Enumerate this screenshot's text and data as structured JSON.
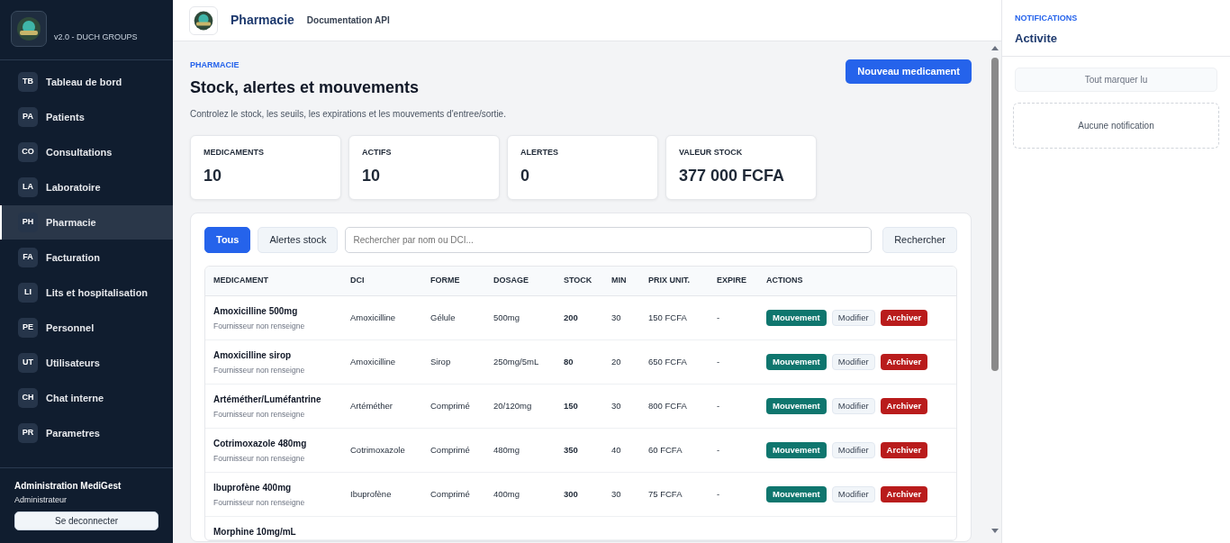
{
  "sidebar": {
    "version": "v2.0 - DUCH GROUPS",
    "items": [
      {
        "badge": "TB",
        "label": "Tableau de bord",
        "selected": false
      },
      {
        "badge": "PA",
        "label": "Patients",
        "selected": false
      },
      {
        "badge": "CO",
        "label": "Consultations",
        "selected": false
      },
      {
        "badge": "LA",
        "label": "Laboratoire",
        "selected": false
      },
      {
        "badge": "PH",
        "label": "Pharmacie",
        "selected": true
      },
      {
        "badge": "FA",
        "label": "Facturation",
        "selected": false
      },
      {
        "badge": "LI",
        "label": "Lits et hospitalisation",
        "selected": false
      },
      {
        "badge": "PE",
        "label": "Personnel",
        "selected": false
      },
      {
        "badge": "UT",
        "label": "Utilisateurs",
        "selected": false
      },
      {
        "badge": "CH",
        "label": "Chat interne",
        "selected": false
      },
      {
        "badge": "PR",
        "label": "Parametres",
        "selected": false
      }
    ],
    "user": {
      "name": "Administration MediGest",
      "role": "Administrateur"
    },
    "logout": "Se deconnecter"
  },
  "header": {
    "title": "Pharmacie",
    "link": "Documentation API"
  },
  "page": {
    "eyebrow": "PHARMACIE",
    "title": "Stock, alertes et mouvements",
    "subtitle": "Controlez le stock, les seuils, les expirations et les mouvements d'entree/sortie.",
    "new_button": "Nouveau medicament"
  },
  "stats": [
    {
      "label": "MEDICAMENTS",
      "value": "10"
    },
    {
      "label": "ACTIFS",
      "value": "10"
    },
    {
      "label": "ALERTES",
      "value": "0"
    },
    {
      "label": "VALEUR STOCK",
      "value": "377 000 FCFA"
    }
  ],
  "filters": [
    {
      "label": "Tous",
      "selected": true
    },
    {
      "label": "Alertes stock",
      "selected": false
    }
  ],
  "search": {
    "placeholder": "Rechercher par nom ou DCI...",
    "button": "Rechercher"
  },
  "table": {
    "columns": [
      "MEDICAMENT",
      "DCI",
      "FORME",
      "DOSAGE",
      "STOCK",
      "MIN",
      "PRIX UNIT.",
      "EXPIRE",
      "ACTIONS"
    ],
    "rows": [
      {
        "name": "Amoxicilline 500mg",
        "supplier": "Fournisseur non renseigne",
        "dci": "Amoxicilline",
        "forme": "Gélule",
        "dosage": "500mg",
        "stock": "200",
        "min": "30",
        "price": "150 FCFA",
        "expire": "-",
        "actions": [
          {
            "label": "Mouvement",
            "kind": "move"
          },
          {
            "label": "Modifier",
            "kind": "edit"
          },
          {
            "label": "Archiver",
            "kind": "archive"
          }
        ]
      },
      {
        "name": "Amoxicilline sirop",
        "supplier": "Fournisseur non renseigne",
        "dci": "Amoxicilline",
        "forme": "Sirop",
        "dosage": "250mg/5mL",
        "stock": "80",
        "min": "20",
        "price": "650 FCFA",
        "expire": "-",
        "actions": [
          {
            "label": "Mouvement",
            "kind": "move"
          },
          {
            "label": "Modifier",
            "kind": "edit"
          },
          {
            "label": "Archiver",
            "kind": "archive"
          }
        ]
      },
      {
        "name": "Artéméther/Luméfantrine",
        "supplier": "Fournisseur non renseigne",
        "dci": "Artéméther",
        "forme": "Comprimé",
        "dosage": "20/120mg",
        "stock": "150",
        "min": "30",
        "price": "800 FCFA",
        "expire": "-",
        "actions": [
          {
            "label": "Mouvement",
            "kind": "move"
          },
          {
            "label": "Modifier",
            "kind": "edit"
          },
          {
            "label": "Archiver",
            "kind": "archive"
          }
        ]
      },
      {
        "name": "Cotrimoxazole 480mg",
        "supplier": "Fournisseur non renseigne",
        "dci": "Cotrimoxazole",
        "forme": "Comprimé",
        "dosage": "480mg",
        "stock": "350",
        "min": "40",
        "price": "60 FCFA",
        "expire": "-",
        "actions": [
          {
            "label": "Mouvement",
            "kind": "move"
          },
          {
            "label": "Modifier",
            "kind": "edit"
          },
          {
            "label": "Archiver",
            "kind": "archive"
          }
        ]
      },
      {
        "name": "Ibuprofène 400mg",
        "supplier": "Fournisseur non renseigne",
        "dci": "Ibuprofène",
        "forme": "Comprimé",
        "dosage": "400mg",
        "stock": "300",
        "min": "30",
        "price": "75 FCFA",
        "expire": "-",
        "actions": [
          {
            "label": "Mouvement",
            "kind": "move"
          },
          {
            "label": "Modifier",
            "kind": "edit"
          },
          {
            "label": "Archiver",
            "kind": "archive"
          }
        ]
      },
      {
        "name": "Morphine 10mg/mL"
      }
    ]
  },
  "notifications": {
    "eyebrow": "NOTIFICATIONS",
    "title": "Activite",
    "mark_all": "Tout marquer lu",
    "empty": "Aucune notification"
  }
}
